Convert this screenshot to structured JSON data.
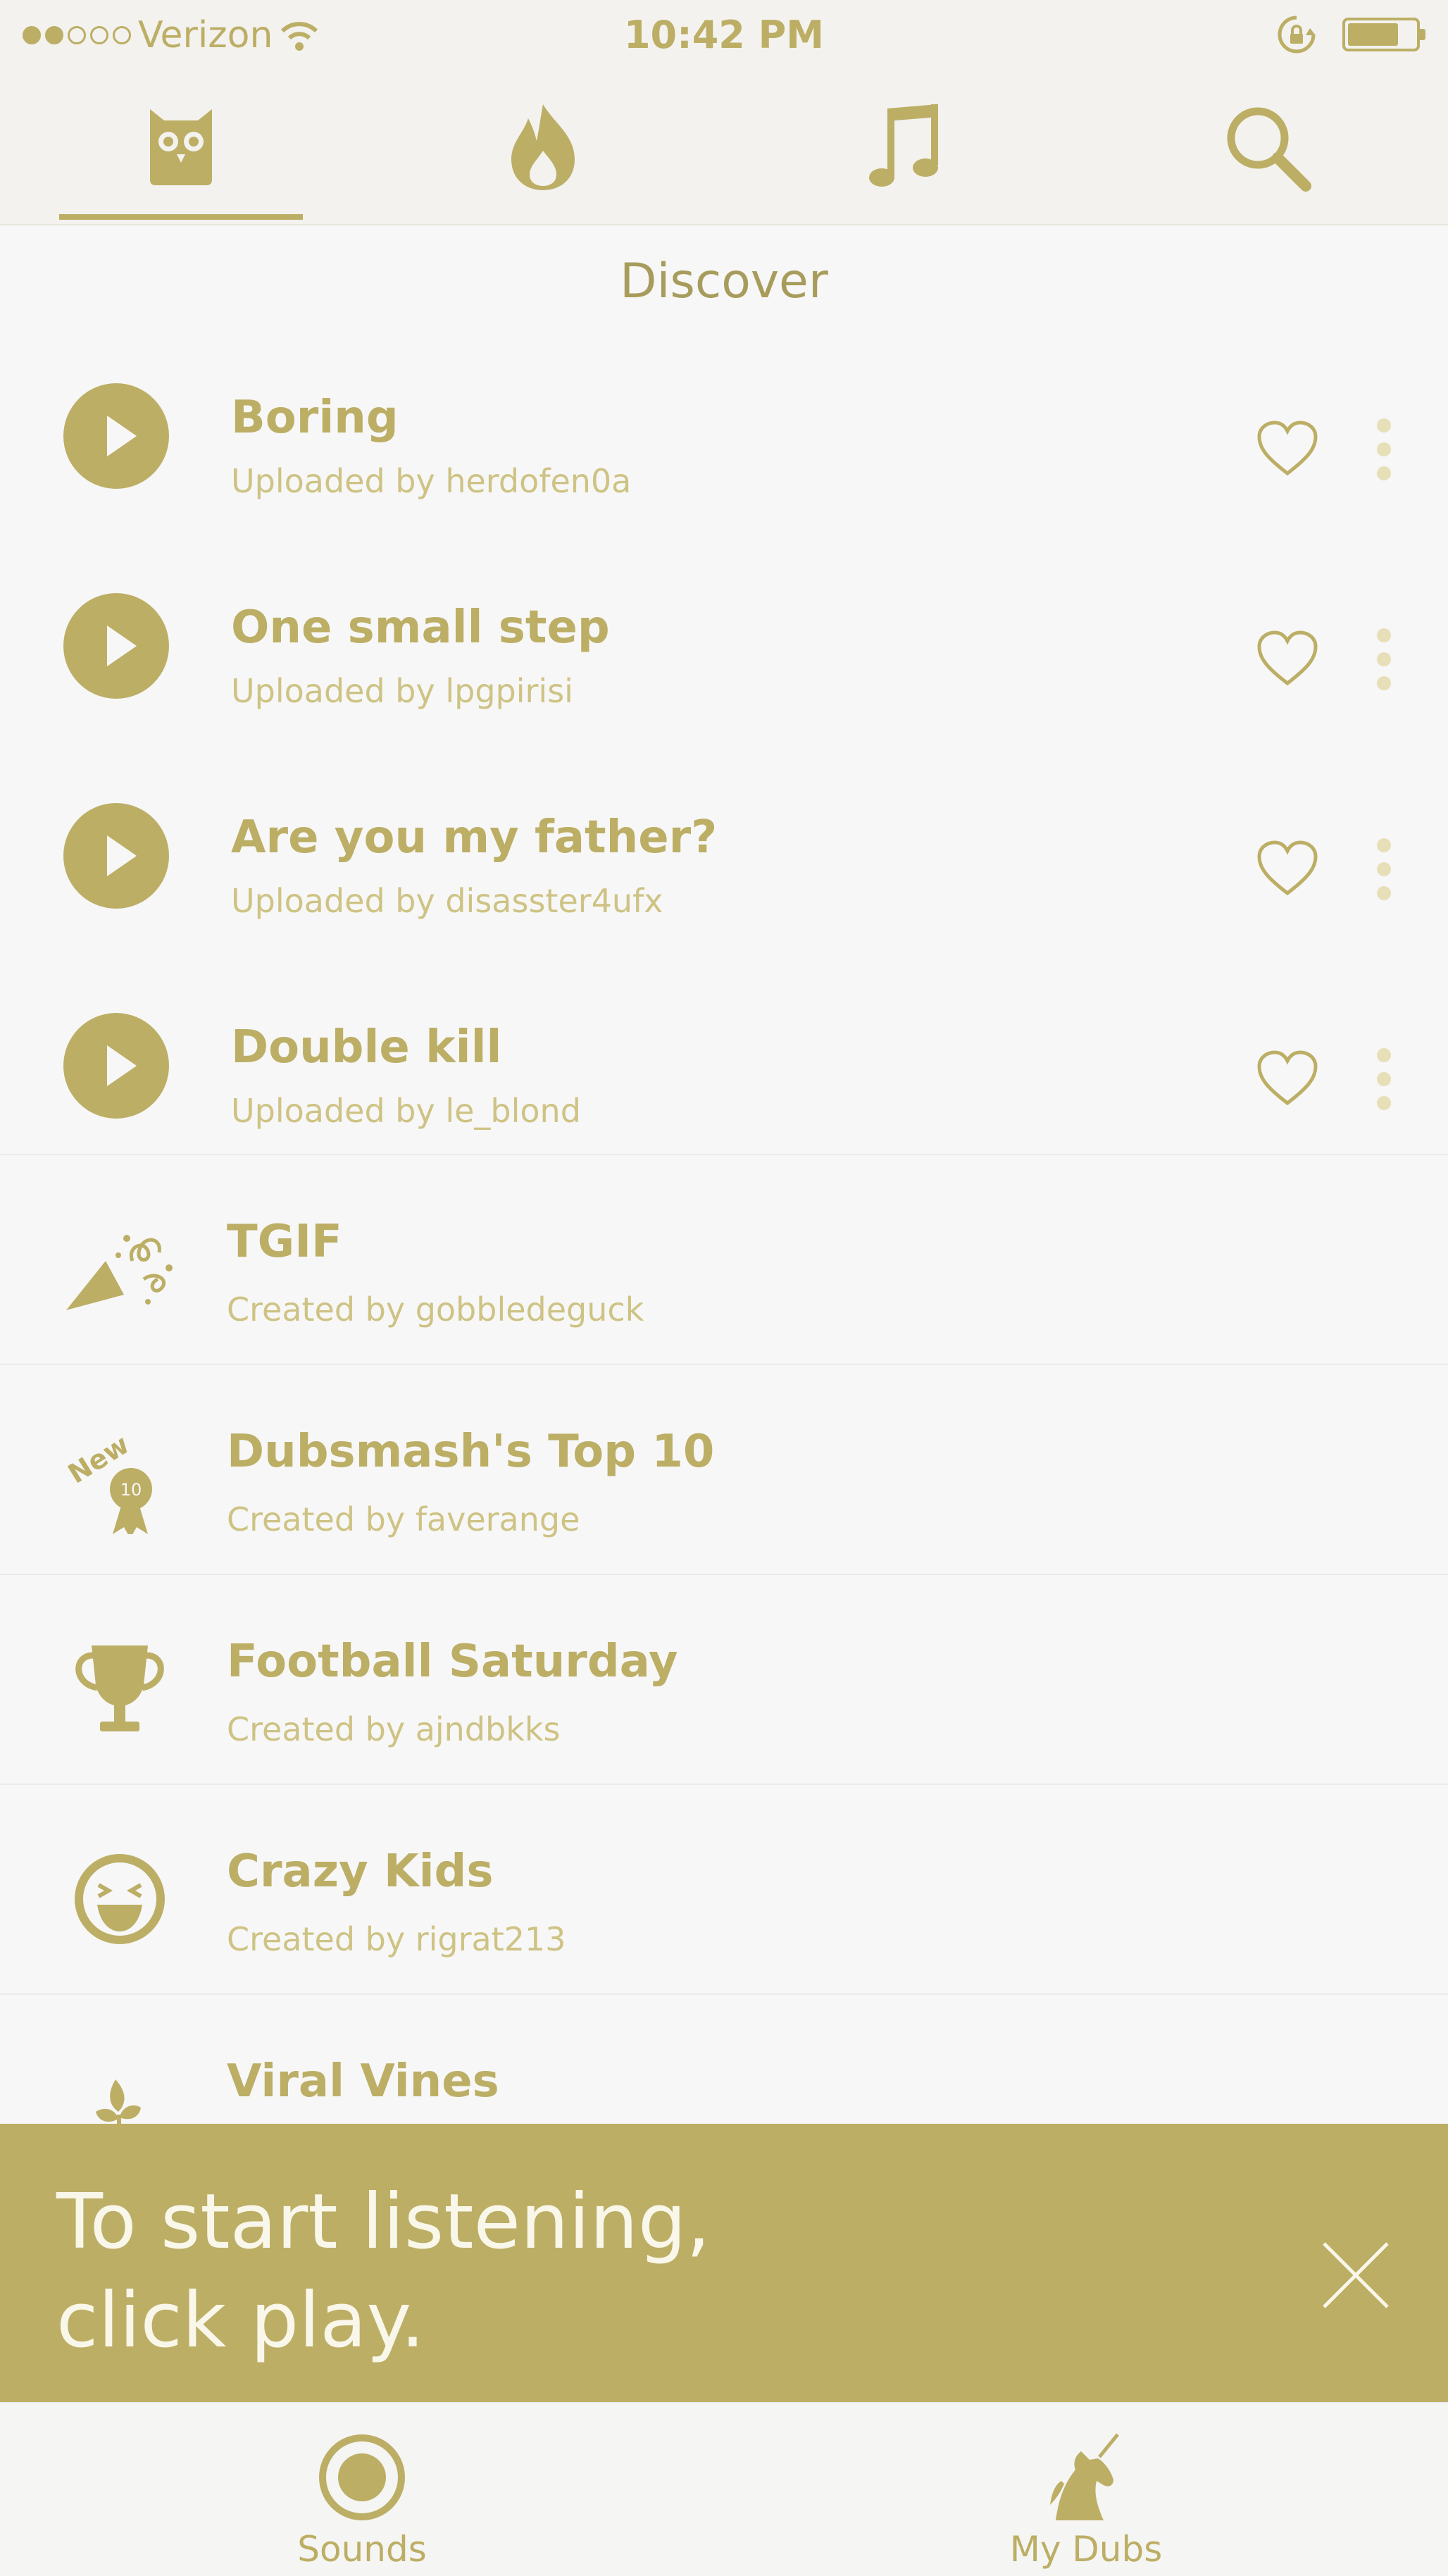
{
  "status_bar": {
    "carrier": "Verizon",
    "time": "10:42 PM",
    "signal_filled": 2,
    "signal_total": 5,
    "battery_level": 0.7
  },
  "nav_tabs": [
    {
      "name": "owl-icon",
      "active": true
    },
    {
      "name": "flame-icon",
      "active": false
    },
    {
      "name": "music-note-icon",
      "active": false
    },
    {
      "name": "search-icon",
      "active": false
    }
  ],
  "page_title": "Discover",
  "sounds": [
    {
      "title": "Boring",
      "subtitle": "Uploaded by herdofen0a"
    },
    {
      "title": "One small step",
      "subtitle": "Uploaded by lpgpirisi"
    },
    {
      "title": "Are you my father?",
      "subtitle": "Uploaded by disasster4ufx"
    },
    {
      "title": "Double kill",
      "subtitle": "Uploaded by le_blond"
    }
  ],
  "collections": [
    {
      "title": "TGIF",
      "subtitle": "Created by gobbledeguck",
      "icon": "party-horn-icon"
    },
    {
      "title": "Dubsmash's Top 10",
      "subtitle": "Created by faverange",
      "icon": "new-award-ribbon-icon",
      "badge_text": "New",
      "badge_number": "10"
    },
    {
      "title": "Football Saturday",
      "subtitle": "Created by ajndbkks",
      "icon": "trophy-icon"
    },
    {
      "title": "Crazy Kids",
      "subtitle": "Created by rigrat213",
      "icon": "laughing-face-icon"
    },
    {
      "title": "Viral Vines",
      "subtitle": "",
      "icon": "sprout-icon"
    }
  ],
  "banner": {
    "line1": "To start listening,",
    "line2": "click play."
  },
  "tab_bar": [
    {
      "label": "Sounds",
      "icon": "sounds-record-icon"
    },
    {
      "label": "My Dubs",
      "icon": "unicorn-icon"
    }
  ],
  "colors": {
    "accent": "#bcae65",
    "background": "#f7f7f7",
    "subtitle": "#cec384"
  }
}
